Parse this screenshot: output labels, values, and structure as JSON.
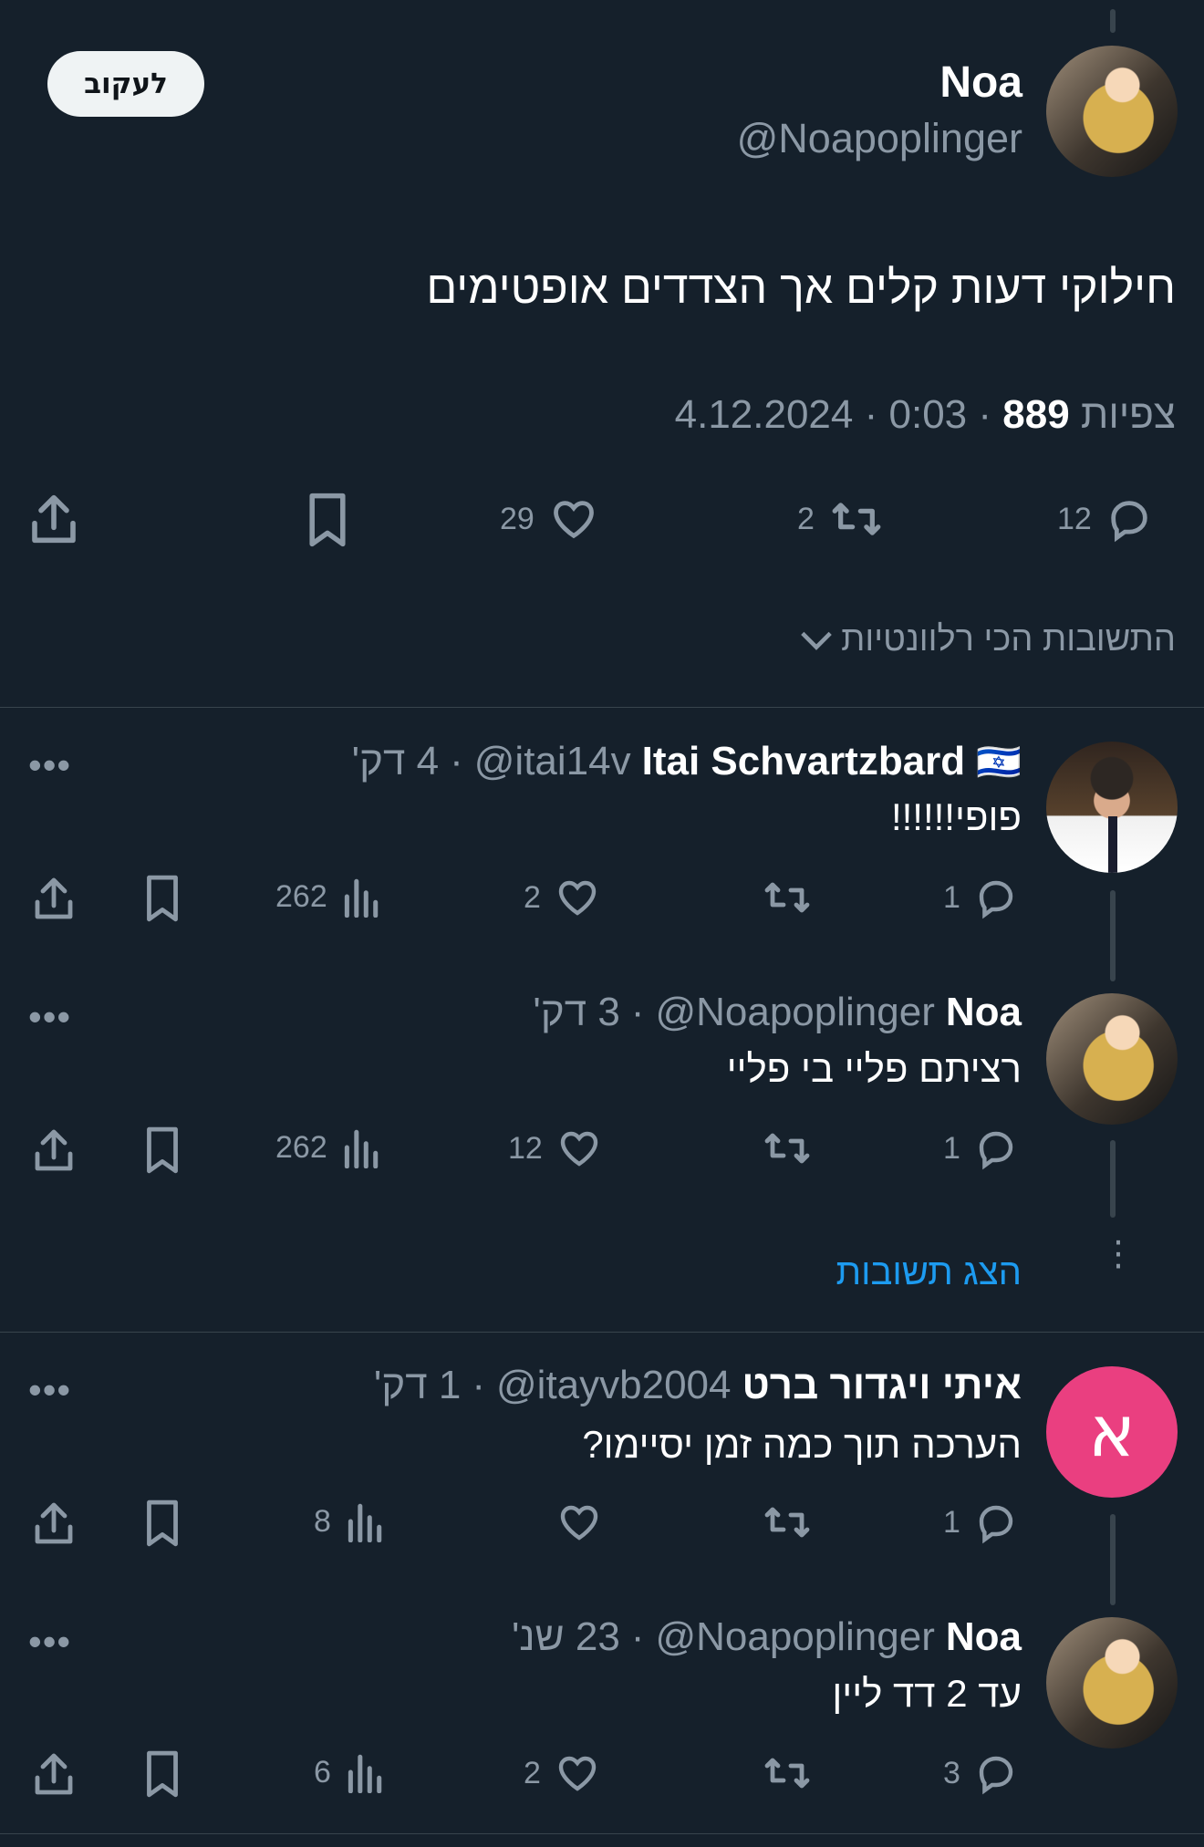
{
  "colors": {
    "background": "#15202b",
    "divider": "#38444d",
    "muted": "#8b98a5",
    "accent": "#1d9bf0",
    "avatar_pink": "#ea3f80"
  },
  "main_post": {
    "author_name": "Noa",
    "handle": "@Noapoplinger",
    "follow_label": "לעקוב",
    "text": "חילוקי דעות קלים אך הצדדים אופטימים",
    "date": "4.12.2024",
    "time": "0:03",
    "views": "889",
    "views_label": "צפיות",
    "counts": {
      "replies": "12",
      "reposts": "2",
      "likes": "29"
    },
    "sort_label": "התשובות הכי רלוונטיות"
  },
  "replies": [
    {
      "name": "Itai Schvartzbard",
      "flag": "🇮🇱",
      "handle": "@itai14v",
      "time": "4 דק'",
      "text": "פופי!!!!!!",
      "replies": "1",
      "reposts": "",
      "likes": "2",
      "views": "262"
    },
    {
      "name": "Noa",
      "handle": "@Noapoplinger",
      "time": "3 דק'",
      "text": "רציתם פליי בי פליי",
      "replies": "1",
      "reposts": "",
      "likes": "12",
      "views": "262"
    },
    {
      "show_replies": "הצג תשובות"
    },
    {
      "name": "איתי ויגדור ברט",
      "avatar_letter": "א",
      "handle": "@itayvb2004",
      "time": "1 דק'",
      "text": "הערכה תוך כמה זמן יסיימו?",
      "replies": "1",
      "reposts": "",
      "likes": "",
      "views": "8"
    },
    {
      "name": "Noa",
      "handle": "@Noapoplinger",
      "time": "23 שנ'",
      "text": "עד 2 דד ליין",
      "replies": "3",
      "reposts": "",
      "likes": "2",
      "views": "6"
    }
  ],
  "icons": [
    "reply-icon",
    "repost-icon",
    "like-icon",
    "bookmark-icon",
    "share-icon",
    "views-icon",
    "more-icon",
    "chevron-down-icon"
  ]
}
